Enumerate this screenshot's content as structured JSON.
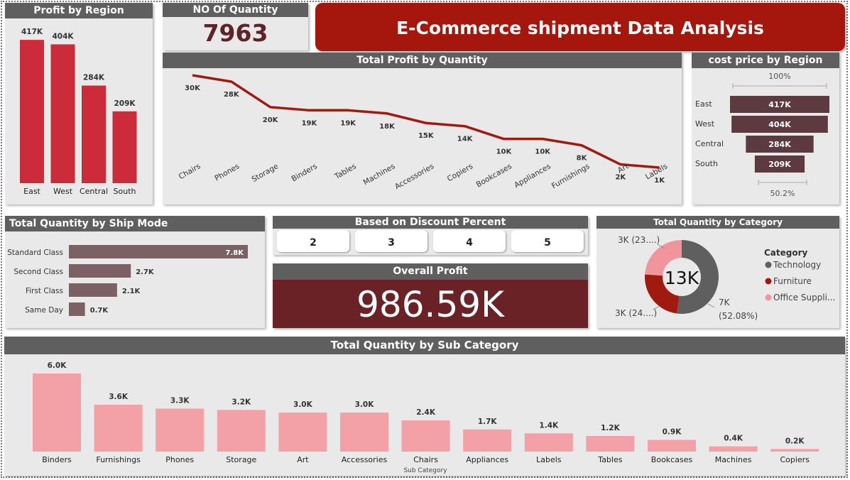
{
  "header": {
    "title": "E-Commerce shipment Data Analysis"
  },
  "quantity_card": {
    "title": "NO Of Quantity",
    "value": "7963"
  },
  "profit_card": {
    "title": "Overall Profit",
    "value": "986.59K"
  },
  "discount_slicer": {
    "title": "Based on Discount Percent",
    "options": [
      "2",
      "3",
      "4",
      "5"
    ]
  },
  "colors": {
    "header": "#5f5f5f",
    "banner": "#a5170c",
    "region_bar": "#cc2b3a",
    "line": "#a11a10",
    "funnel": "#5d3a3f",
    "ship_bar": "#7b6064",
    "subcat_bar": "#f4a0a7",
    "profit_panel": "#6b2226"
  },
  "chart_data": [
    {
      "id": "profit_by_region",
      "type": "bar",
      "title": "Profit by Region",
      "categories": [
        "East",
        "West",
        "Central",
        "South"
      ],
      "values": [
        417,
        404,
        284,
        209
      ],
      "labels": [
        "417K",
        "404K",
        "284K",
        "209K"
      ],
      "unit": "K",
      "ylim": [
        0,
        440
      ]
    },
    {
      "id": "profit_by_quantity",
      "type": "line",
      "title": "Total Profit by Quantity",
      "categories": [
        "Chairs",
        "Phones",
        "Storage",
        "Binders",
        "Tables",
        "Machines",
        "Accessories",
        "Copiers",
        "Bookcases",
        "Appliances",
        "Furnishings",
        "Art",
        "Labels"
      ],
      "values": [
        30,
        28,
        20,
        19,
        19,
        18,
        15,
        14,
        10,
        10,
        8,
        2,
        1
      ],
      "labels": [
        "30K",
        "28K",
        "20K",
        "19K",
        "19K",
        "18K",
        "15K",
        "14K",
        "10K",
        "10K",
        "8K",
        "2K",
        "1K"
      ],
      "unit": "K"
    },
    {
      "id": "cost_price_by_region",
      "type": "bar",
      "title": "cost price by Region",
      "categories": [
        "East",
        "West",
        "Central",
        "South"
      ],
      "values": [
        417,
        404,
        284,
        209
      ],
      "labels": [
        "417K",
        "404K",
        "284K",
        "209K"
      ],
      "top_label": "100%",
      "bottom_label": "50.2%"
    },
    {
      "id": "quantity_by_ship_mode",
      "type": "bar",
      "orientation": "horizontal",
      "title": "Total Quantity by Ship Mode",
      "categories": [
        "Standard Class",
        "Second Class",
        "First Class",
        "Same Day"
      ],
      "values": [
        7.8,
        2.7,
        2.1,
        0.7
      ],
      "labels": [
        "7.8K",
        "2.7K",
        "2.1K",
        "0.7K"
      ],
      "unit": "K"
    },
    {
      "id": "quantity_by_category",
      "type": "pie",
      "title": "Total Quantity by Category",
      "center_label": "13K",
      "legend_title": "Category",
      "legend": [
        "Technology",
        "Furniture",
        "Office Suppli..."
      ],
      "slices": [
        {
          "name": "Technology",
          "share": 52.08,
          "label": "7K",
          "label2": "(52.08%)",
          "color": "#5f5f5f"
        },
        {
          "name": "Furniture",
          "share": 24.0,
          "label": "3K (24....)",
          "color": "#a11a10"
        },
        {
          "name": "Office Supplies",
          "share": 23.92,
          "label": "3K (23....)",
          "color": "#f0959c"
        }
      ]
    },
    {
      "id": "quantity_by_sub_category",
      "type": "bar",
      "title": "Total Quantity by Sub Category",
      "xlabel": "Sub Category",
      "categories": [
        "Binders",
        "Furnishings",
        "Phones",
        "Storage",
        "Art",
        "Accessories",
        "Chairs",
        "Appliances",
        "Labels",
        "Tables",
        "Bookcases",
        "Machines",
        "Copiers"
      ],
      "values": [
        6.0,
        3.6,
        3.3,
        3.2,
        3.0,
        3.0,
        2.4,
        1.7,
        1.4,
        1.2,
        0.9,
        0.4,
        0.2
      ],
      "labels": [
        "6.0K",
        "3.6K",
        "3.3K",
        "3.2K",
        "3.0K",
        "3.0K",
        "2.4K",
        "1.7K",
        "1.4K",
        "1.2K",
        "0.9K",
        "0.4K",
        "0.2K"
      ],
      "unit": "K"
    }
  ]
}
